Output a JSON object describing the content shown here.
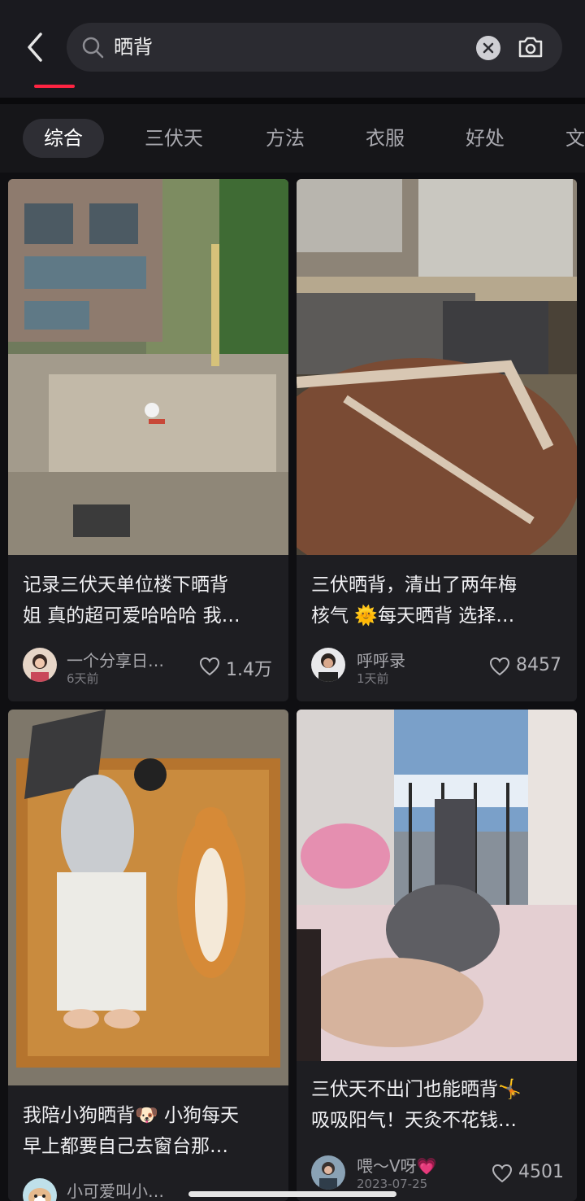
{
  "search": {
    "query": "晒背"
  },
  "tabs": [
    "综合",
    "三伏天",
    "方法",
    "衣服",
    "好处",
    "文"
  ],
  "cards": [
    {
      "title_line1": "记录三伏天单位楼下晒背",
      "title_line2": "姐 真的超可爱哈哈哈 我…",
      "author": "一个分享日…",
      "time": "6天前",
      "likes": "1.4万"
    },
    {
      "title_line1": "三伏晒背，清出了两年梅",
      "title_line2": "核气 🌞每天晒背 选择…",
      "author": "呼呼录",
      "time": "1天前",
      "likes": "8457"
    },
    {
      "title_line1": "我陪小狗晒背🐶 小狗每天",
      "title_line2": "早上都要自己去窗台那…",
      "author": "小可爱叫小…",
      "time": "",
      "likes": ""
    },
    {
      "title_line1": "三伏天不出门也能晒背🤸",
      "title_line2": "吸吸阳气！天灸不花钱…",
      "author": "喂～V呀💗",
      "time": "2023-07-25",
      "likes": "4501"
    }
  ],
  "icons": {
    "back": "chevron-left-icon",
    "search": "search-icon",
    "clear": "clear-icon",
    "camera": "camera-icon",
    "like": "heart-icon"
  },
  "colors": {
    "accent": "#ff2442",
    "background": "#0f0f12",
    "card": "#1e1e22"
  }
}
